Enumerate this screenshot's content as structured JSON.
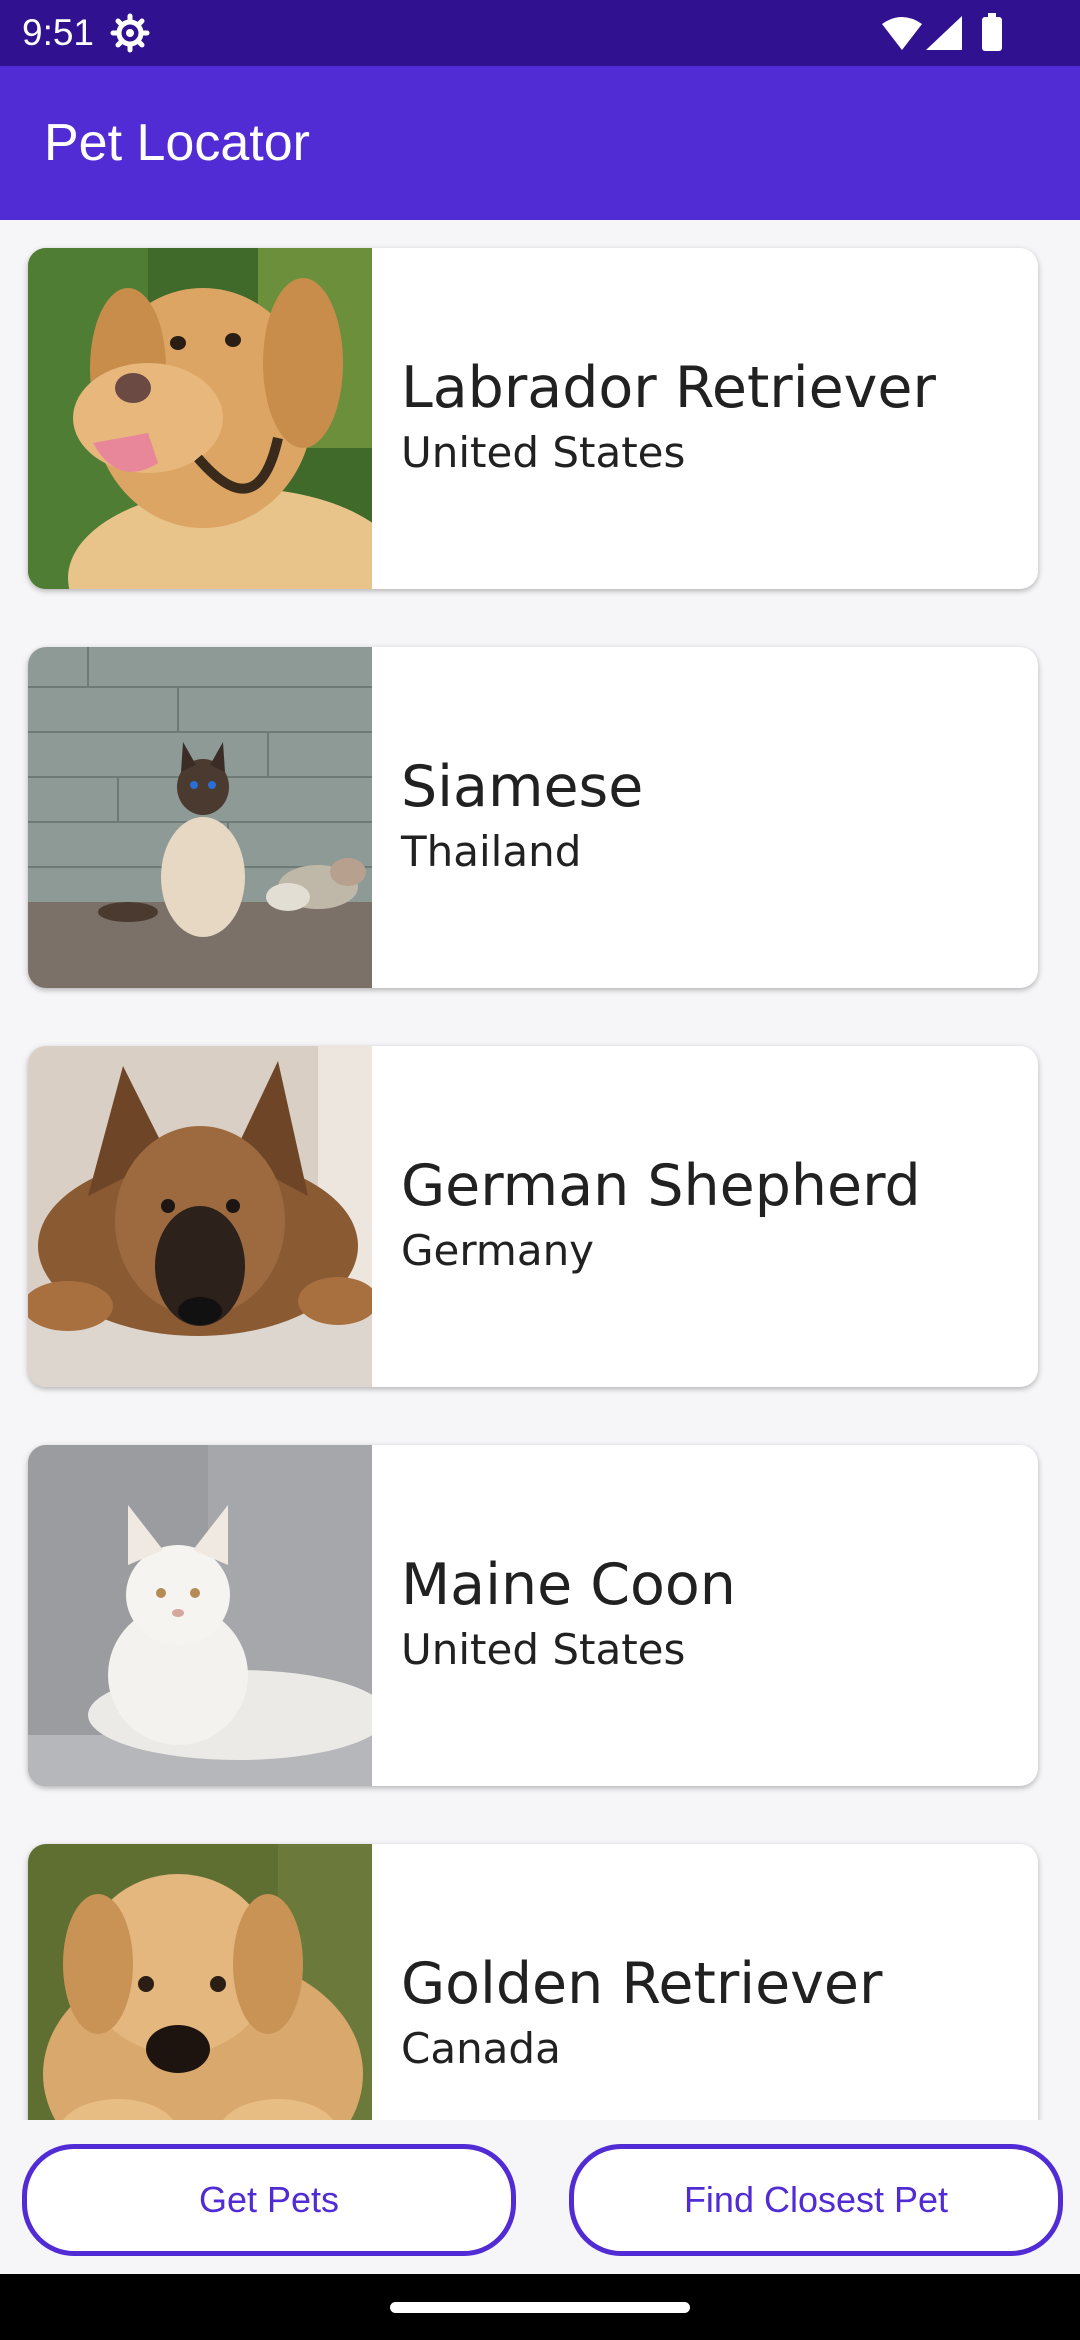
{
  "status_bar": {
    "time": "9:51",
    "icons": [
      "settings-gear-icon",
      "wifi-icon",
      "cell-signal-icon",
      "battery-icon"
    ]
  },
  "app_bar": {
    "title": "Pet Locator",
    "color": "#512bd4"
  },
  "pets": [
    {
      "name": "Labrador Retriever",
      "location": "United States",
      "photo": "labrador-photo"
    },
    {
      "name": "Siamese",
      "location": "Thailand",
      "photo": "siamese-photo"
    },
    {
      "name": "German Shepherd",
      "location": "Germany",
      "photo": "german-shepherd-photo"
    },
    {
      "name": "Maine Coon",
      "location": "United States",
      "photo": "maine-coon-photo"
    },
    {
      "name": "Golden Retriever",
      "location": "Canada",
      "photo": "golden-retriever-photo"
    }
  ],
  "buttons": {
    "get_pets": "Get Pets",
    "find_closest": "Find Closest Pet"
  },
  "colors": {
    "status_bar": "#30118f",
    "accent": "#512bd4",
    "background": "#f6f5f7"
  }
}
